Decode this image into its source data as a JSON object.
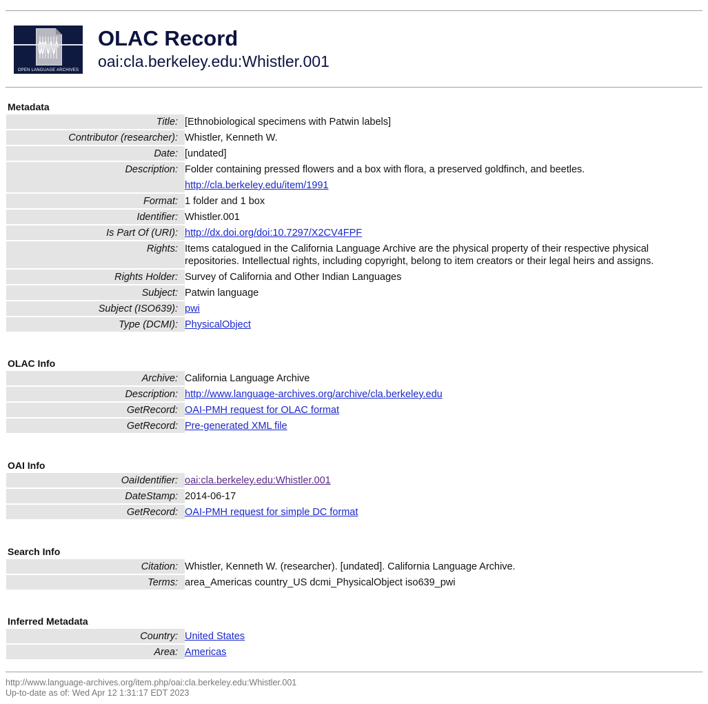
{
  "header": {
    "logo_text": "OPEN LANGUAGE ARCHIVES",
    "title": "OLAC Record",
    "subtitle": "oai:cla.berkeley.edu:Whistler.001"
  },
  "metadata": {
    "heading": "Metadata",
    "rows": [
      {
        "label": "Title:",
        "value": "[Ethnobiological specimens with Patwin labels]"
      },
      {
        "label": "Contributor (researcher):",
        "value": "Whistler, Kenneth W."
      },
      {
        "label": "Date:",
        "value": "[undated]"
      },
      {
        "label": "Description:",
        "value": "Folder containing pressed flowers and a box with flora, a preserved goldfinch, and beetles.",
        "link": "http://cla.berkeley.edu/item/1991"
      },
      {
        "label": "Format:",
        "value": "1 folder and 1 box"
      },
      {
        "label": "Identifier:",
        "value": "Whistler.001"
      },
      {
        "label": "Is Part Of (URI):",
        "link": "http://dx.doi.org/doi:10.7297/X2CV4FPF"
      },
      {
        "label": "Rights:",
        "value": "Items catalogued in the California Language Archive are the physical property of their respective physical repositories. Intellectual rights, including copyright, belong to item creators or their legal heirs and assigns."
      },
      {
        "label": "Rights Holder:",
        "value": "Survey of California and Other Indian Languages"
      },
      {
        "label": "Subject:",
        "value": "Patwin language"
      },
      {
        "label": "Subject (ISO639):",
        "link": "pwi"
      },
      {
        "label": "Type (DCMI):",
        "link": "PhysicalObject"
      }
    ]
  },
  "olac_info": {
    "heading": "OLAC Info",
    "rows": [
      {
        "label": "Archive:",
        "value": "California Language Archive"
      },
      {
        "label": "Description:",
        "link": "http://www.language-archives.org/archive/cla.berkeley.edu"
      },
      {
        "label": "GetRecord:",
        "link": "OAI-PMH request for OLAC format"
      },
      {
        "label": "GetRecord:",
        "link": "Pre-generated XML file"
      }
    ]
  },
  "oai_info": {
    "heading": "OAI Info",
    "rows": [
      {
        "label": "OaiIdentifier:",
        "link": "oai:cla.berkeley.edu:Whistler.001"
      },
      {
        "label": "DateStamp:",
        "value": "2014-06-17"
      },
      {
        "label": "GetRecord:",
        "link": "OAI-PMH request for simple DC format"
      }
    ]
  },
  "search_info": {
    "heading": "Search Info",
    "rows": [
      {
        "label": "Citation:",
        "value": "Whistler, Kenneth W. (researcher). [undated]. California Language Archive."
      },
      {
        "label": "Terms:",
        "value": "area_Americas country_US dcmi_PhysicalObject iso639_pwi"
      }
    ]
  },
  "inferred": {
    "heading": "Inferred Metadata",
    "rows": [
      {
        "label": "Country:",
        "link": "United States"
      },
      {
        "label": "Area:",
        "link": "Americas"
      }
    ]
  },
  "footer": {
    "url": "http://www.language-archives.org/item.php/oai:cla.berkeley.edu:Whistler.001",
    "updated": "Up-to-date as of: Wed Apr 12 1:31:17 EDT 2023"
  },
  "colors": {
    "link": "#1a28c8",
    "visited_link": "#5a2a86",
    "label_bg": "#e4e4e4",
    "title": "#0d1340"
  },
  "icons": {
    "logo": "olac-logo-icon"
  }
}
